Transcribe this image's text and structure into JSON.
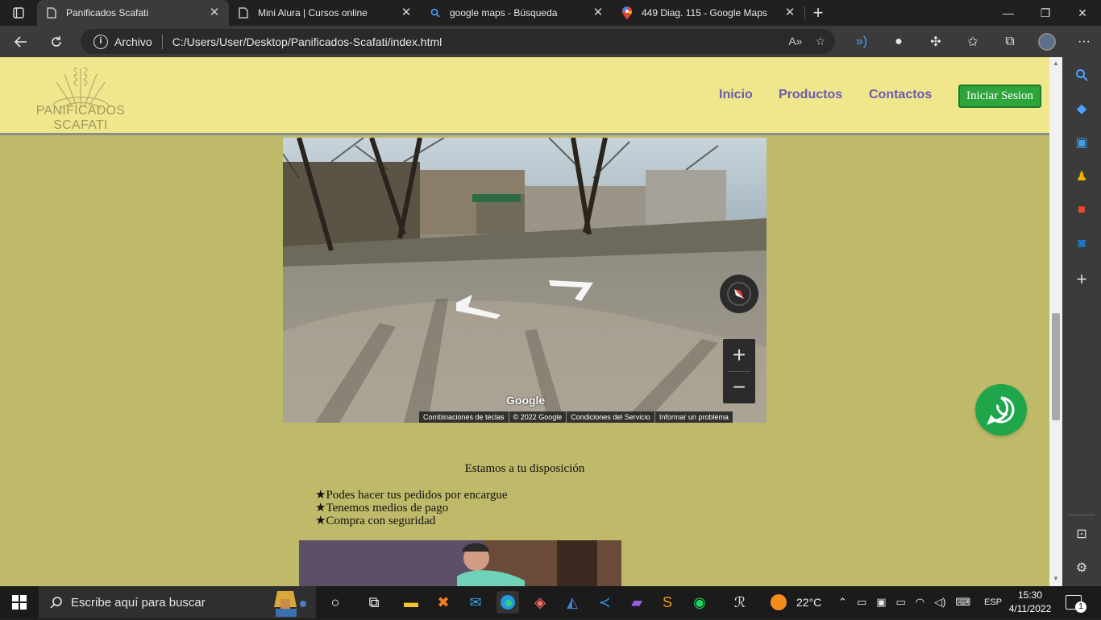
{
  "browser": {
    "tabs": [
      {
        "title": "Panificados Scafati",
        "active": true,
        "icon": "page-icon"
      },
      {
        "title": "Mini Alura | Cursos online",
        "active": false,
        "icon": "page-icon"
      },
      {
        "title": "google maps - Búsqueda",
        "active": false,
        "icon": "search-icon"
      },
      {
        "title": "449 Diag. 115 - Google Maps",
        "active": false,
        "icon": "maps-pin-icon"
      }
    ],
    "address": {
      "scheme_label": "Archivo",
      "url": "C:/Users/User/Desktop/Panificados-Scafati/index.html"
    }
  },
  "site": {
    "logo_text": "PANIFICADOS SCAFATI",
    "nav": [
      "Inicio",
      "Productos",
      "Contactos"
    ],
    "login_label": "Iniciar Sesion",
    "map": {
      "brand": "Google",
      "footer": [
        "Combinaciones de teclas",
        "© 2022 Google",
        "Condiciones del Servicio",
        "Informar un problema"
      ],
      "zoom_in": "+",
      "zoom_out": "−"
    },
    "availability": "Estamos a tu disposición",
    "features": [
      "★Podes hacer tus pedidos por encargue",
      "★Tenemos medios de pago",
      "★Compra con seguridad"
    ],
    "colors": {
      "header_bg": "#f0e68c",
      "page_bg": "#bfba6a",
      "nav_link": "#6b5bb0",
      "login_button": "#2ea53a",
      "whatsapp": "#1fa64a"
    }
  },
  "taskbar": {
    "search_placeholder": "Escribe aquí para buscar",
    "weather": "22°C",
    "language": "ESP",
    "time": "15:30",
    "date": "4/11/2022",
    "notification_count": "1"
  }
}
